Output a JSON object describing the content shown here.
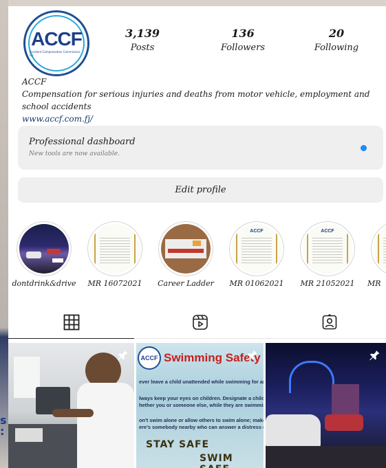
{
  "profile": {
    "avatar_logo": "ACCF",
    "avatar_subtitle": "Accident Compensation Commission, Fiji",
    "stats": [
      {
        "value": "3,139",
        "label": "Posts"
      },
      {
        "value": "136",
        "label": "Followers"
      },
      {
        "value": "20",
        "label": "Following"
      }
    ],
    "name": "ACCF",
    "bio": "Compensation for serious injuries and deaths from motor vehicle, employment and school accidents",
    "link": "www.accf.com.fj/"
  },
  "dashboard": {
    "title": "Professional dashboard",
    "subtitle": "New tools are now available."
  },
  "edit_profile_label": "Edit profile",
  "highlights": [
    {
      "label": "dontdrink&drive"
    },
    {
      "label": "MR 16072021"
    },
    {
      "label": "Career Ladder"
    },
    {
      "label": "MR 01062021"
    },
    {
      "label": "MR 21052021"
    },
    {
      "label": "MR"
    }
  ],
  "tabs": [
    {
      "icon": "grid-icon"
    },
    {
      "icon": "reels-icon"
    },
    {
      "icon": "tagged-icon"
    }
  ],
  "posts": [
    {
      "pinned": true
    },
    {
      "pinned": true,
      "logo": "ACCF",
      "title": "Swimming Safety Tip",
      "lines": [
        "ever leave a child unattended while swimming for any rea",
        "lways keep your eyes on children. Designate a child watch",
        "hether you or someone else, while they are swimming.",
        "on't swim alone or allow others to swim alone; make sure",
        "ere's somebody nearby who can answer a distress call."
      ],
      "stay_safe": "STAY SAFE",
      "swim_safe": "SWIM SAFE"
    },
    {
      "pinned": true
    }
  ],
  "colors": {
    "accent": "#1f8cf3",
    "brand": "#1d3f8a",
    "swim_title": "#c81e1e"
  }
}
